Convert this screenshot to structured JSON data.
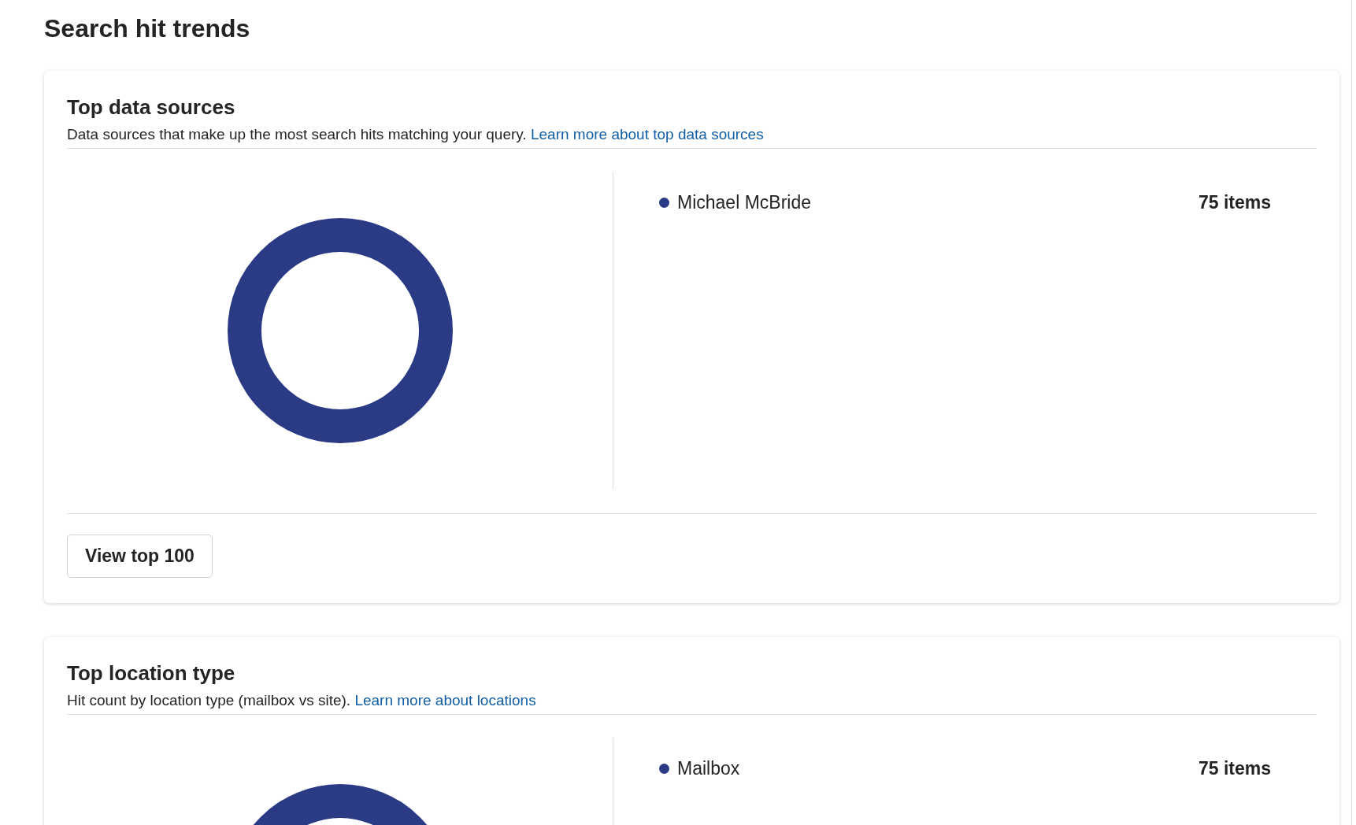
{
  "page_title": "Search hit trends",
  "cards": [
    {
      "title": "Top data sources",
      "description": "Data sources that make up the most search hits matching your query.",
      "link": "Learn more about top data sources",
      "legend": [
        {
          "label": "Michael McBride",
          "count": "75 items",
          "color": "#2b3a85"
        }
      ],
      "button": "View top 100"
    },
    {
      "title": "Top location type",
      "description": "Hit count by location type (mailbox vs site).",
      "link": "Learn more about locations",
      "legend": [
        {
          "label": "Mailbox",
          "count": "75 items",
          "color": "#2b3a85"
        }
      ]
    }
  ]
}
